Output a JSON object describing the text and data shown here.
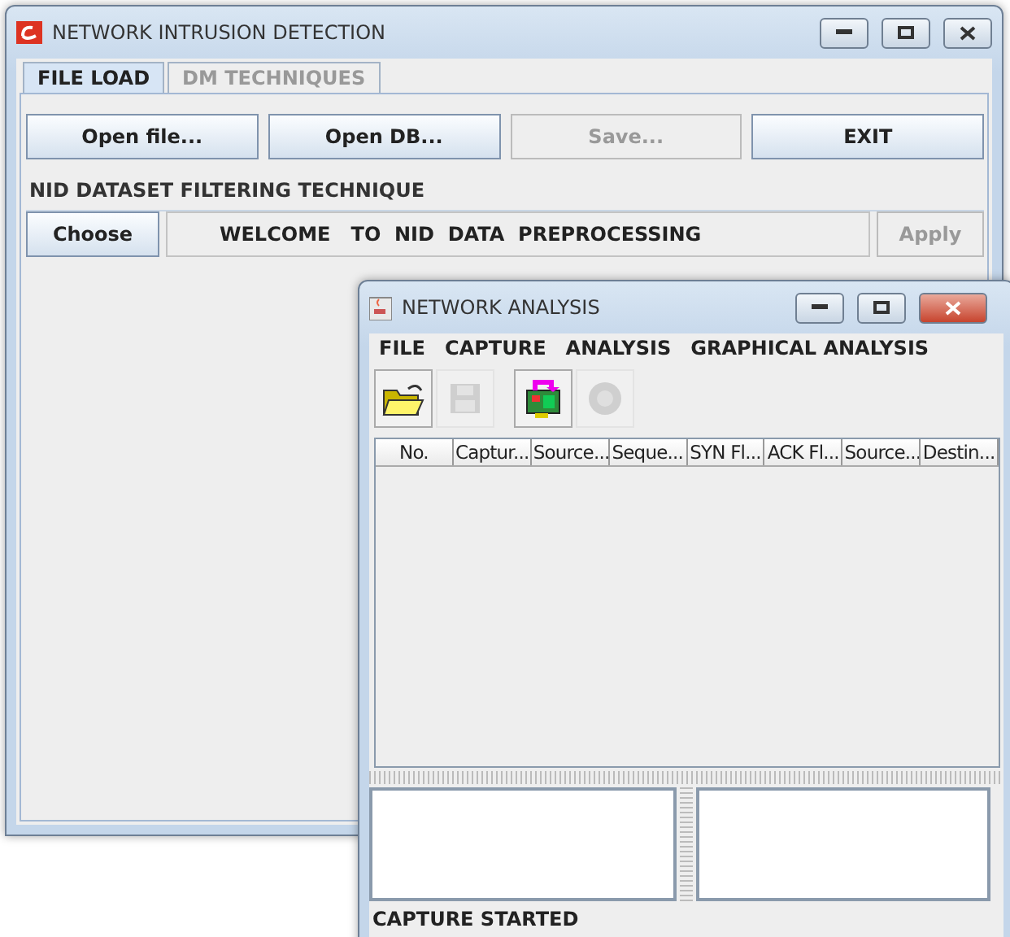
{
  "main_window": {
    "title": "NETWORK INTRUSION DETECTION",
    "tabs": [
      {
        "label": "FILE LOAD",
        "selected": true
      },
      {
        "label": "DM TECHNIQUES",
        "selected": false
      }
    ],
    "buttons": [
      {
        "label": "Open file...",
        "disabled": false
      },
      {
        "label": "Open DB...",
        "disabled": false
      },
      {
        "label": "Save...",
        "disabled": true
      },
      {
        "label": "EXIT",
        "disabled": false
      }
    ],
    "group_title": "NID DATASET FILTERING TECHNIQUE",
    "choose_button": {
      "label": "Choose",
      "disabled": false
    },
    "message": "WELCOME   TO  NID  DATA  PREPROCESSING",
    "apply_button": {
      "label": "Apply",
      "disabled": true
    }
  },
  "analysis_window": {
    "title": "NETWORK ANALYSIS",
    "menu": [
      "FILE",
      "CAPTURE",
      "ANALYSIS",
      "GRAPHICAL ANALYSIS"
    ],
    "toolbar": [
      {
        "kind": "open",
        "disabled": false
      },
      {
        "kind": "save",
        "disabled": true
      },
      {
        "kind": "capture",
        "disabled": false
      },
      {
        "kind": "stop",
        "disabled": true
      }
    ],
    "table": {
      "columns": [
        "No.",
        "Captur...",
        "Source...",
        "Seque...",
        "SYN Fl...",
        "ACK Fl...",
        "Source...",
        "Destin..."
      ]
    },
    "status": "CAPTURE STARTED"
  }
}
